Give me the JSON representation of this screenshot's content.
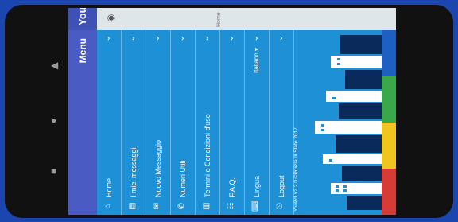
{
  "app": {
    "title": "YouPol"
  },
  "drawer": {
    "header": "Menu",
    "items": [
      {
        "icon": "home-icon",
        "glyph": "⌂",
        "label": "Home"
      },
      {
        "icon": "messages-icon",
        "glyph": "▤",
        "label": "I miei messaggi"
      },
      {
        "icon": "new-message-icon",
        "glyph": "✉",
        "label": "Nuovo Messaggio"
      },
      {
        "icon": "phone-icon",
        "glyph": "✆",
        "label": "Numeri Utili"
      },
      {
        "icon": "document-icon",
        "glyph": "▥",
        "label": "Termini e Condizioni d'uso"
      },
      {
        "icon": "faq-icon",
        "glyph": "☷",
        "label": "F.A.Q."
      },
      {
        "icon": "language-icon",
        "glyph": "⌨",
        "label": "Lingua",
        "value": "Italiano ▾"
      },
      {
        "icon": "logout-icon",
        "glyph": "⎋",
        "label": "Logout"
      }
    ],
    "version": "YouPol v2.2.0 ©Polizia di Stato 2017"
  },
  "map": {
    "label": "Home"
  },
  "colors": {
    "drawer": "#1e90d6",
    "header": "#4a5cc4",
    "tile_red": "#d63b36",
    "tile_yellow": "#f0c51d",
    "tile_green": "#3aa84a",
    "tile_blue": "#1e5fc2"
  }
}
